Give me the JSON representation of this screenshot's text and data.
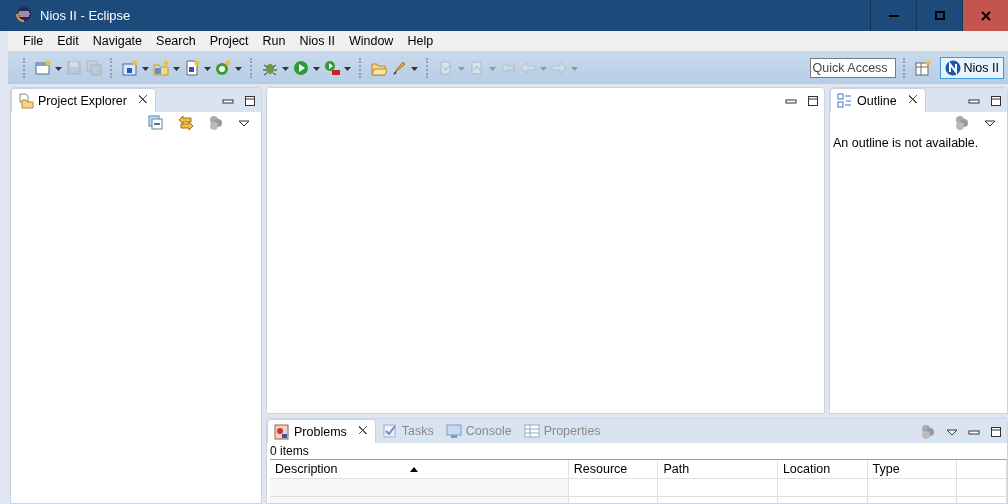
{
  "window": {
    "title": "Nios II - Eclipse"
  },
  "menu": [
    "File",
    "Edit",
    "Navigate",
    "Search",
    "Project",
    "Run",
    "Nios II",
    "Window",
    "Help"
  ],
  "toolbar": {
    "buttons": [
      {
        "disabled": false
      },
      {
        "disabled": true
      },
      {
        "disabled": true
      },
      {
        "disabled": false
      },
      {
        "disabled": false
      },
      {
        "disabled": false
      },
      {
        "disabled": false
      },
      {
        "disabled": false
      },
      {
        "disabled": false
      },
      {
        "disabled": false
      },
      {
        "disabled": false
      },
      {
        "disabled": false
      },
      {
        "disabled": true
      },
      {
        "disabled": true
      },
      {
        "disabled": true
      },
      {
        "disabled": true
      },
      {
        "disabled": true
      }
    ]
  },
  "quick_access": {
    "placeholder": "Quick Access"
  },
  "perspective": {
    "label": "Nios II",
    "selected": true
  },
  "project_explorer": {
    "tab": {
      "label": "Project Explorer",
      "selected": true
    }
  },
  "outline": {
    "tab": {
      "label": "Outline",
      "selected": true
    },
    "message": "An outline is not available."
  },
  "bottom_panel": {
    "tabs": [
      {
        "label": "Problems",
        "selected": true
      },
      {
        "label": "Tasks",
        "selected": false
      },
      {
        "label": "Console",
        "selected": false
      },
      {
        "label": "Properties",
        "selected": false
      }
    ],
    "status": "0 items",
    "columns": [
      {
        "label": "Description",
        "sorted": true
      },
      {
        "label": "Resource",
        "sorted": false
      },
      {
        "label": "Path",
        "sorted": false
      },
      {
        "label": "Location",
        "sorted": false
      },
      {
        "label": "Type",
        "sorted": false
      }
    ]
  }
}
